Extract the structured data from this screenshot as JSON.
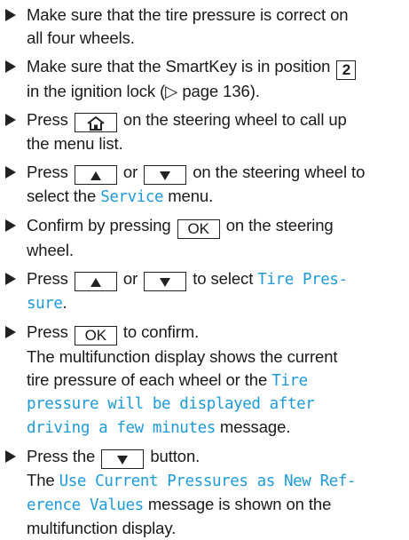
{
  "steps": [
    {
      "l1": "Make sure that the tire pressure is correct on",
      "l2": "all four wheels."
    },
    {
      "l1": "Make sure that the SmartKey is in position",
      "position": "2",
      "l2_pre": "in the ignition lock (",
      "pageref_arrow": "▷",
      "pageref": " page 136",
      "l2_post": ")."
    },
    {
      "pre": "Press",
      "post": "on the steering wheel to call up",
      "l2": "the menu list."
    },
    {
      "pre": "Press",
      "or": "or",
      "post": "on the steering wheel to",
      "l2_pre": "select the",
      "menu": "Service",
      "l2_post": "menu."
    },
    {
      "pre": "Confirm by pressing",
      "ok": "OK",
      "post": "on the steering",
      "l2": "wheel."
    },
    {
      "pre": "Press",
      "or": "or",
      "post": "to select",
      "disp1": "Tire Pres-",
      "disp2": "sure",
      "end": "."
    },
    {
      "pre": "Press",
      "ok": "OK",
      "post": "to confirm.",
      "l2": "The multifunction display shows the current",
      "l3_pre": "tire pressure of each wheel or the",
      "disp1": "Tire",
      "disp2": "pressure will be displayed after",
      "disp3": "driving a few minutes",
      "l5_post": "message."
    },
    {
      "pre": "Press the",
      "post": "button.",
      "l2_pre": "The",
      "disp1": "Use Current Pressures as New Ref-",
      "disp2": "erence Values",
      "l3_post": "message is shown on the",
      "l4": "multifunction display."
    }
  ],
  "icons": {
    "home": "home-icon",
    "up": "arrow-up-icon",
    "down": "arrow-down-icon",
    "bullet": "right-triangle-bullet-icon"
  },
  "colors": {
    "display_text": "#1e9bd7",
    "body_text": "#1a1a1a"
  }
}
